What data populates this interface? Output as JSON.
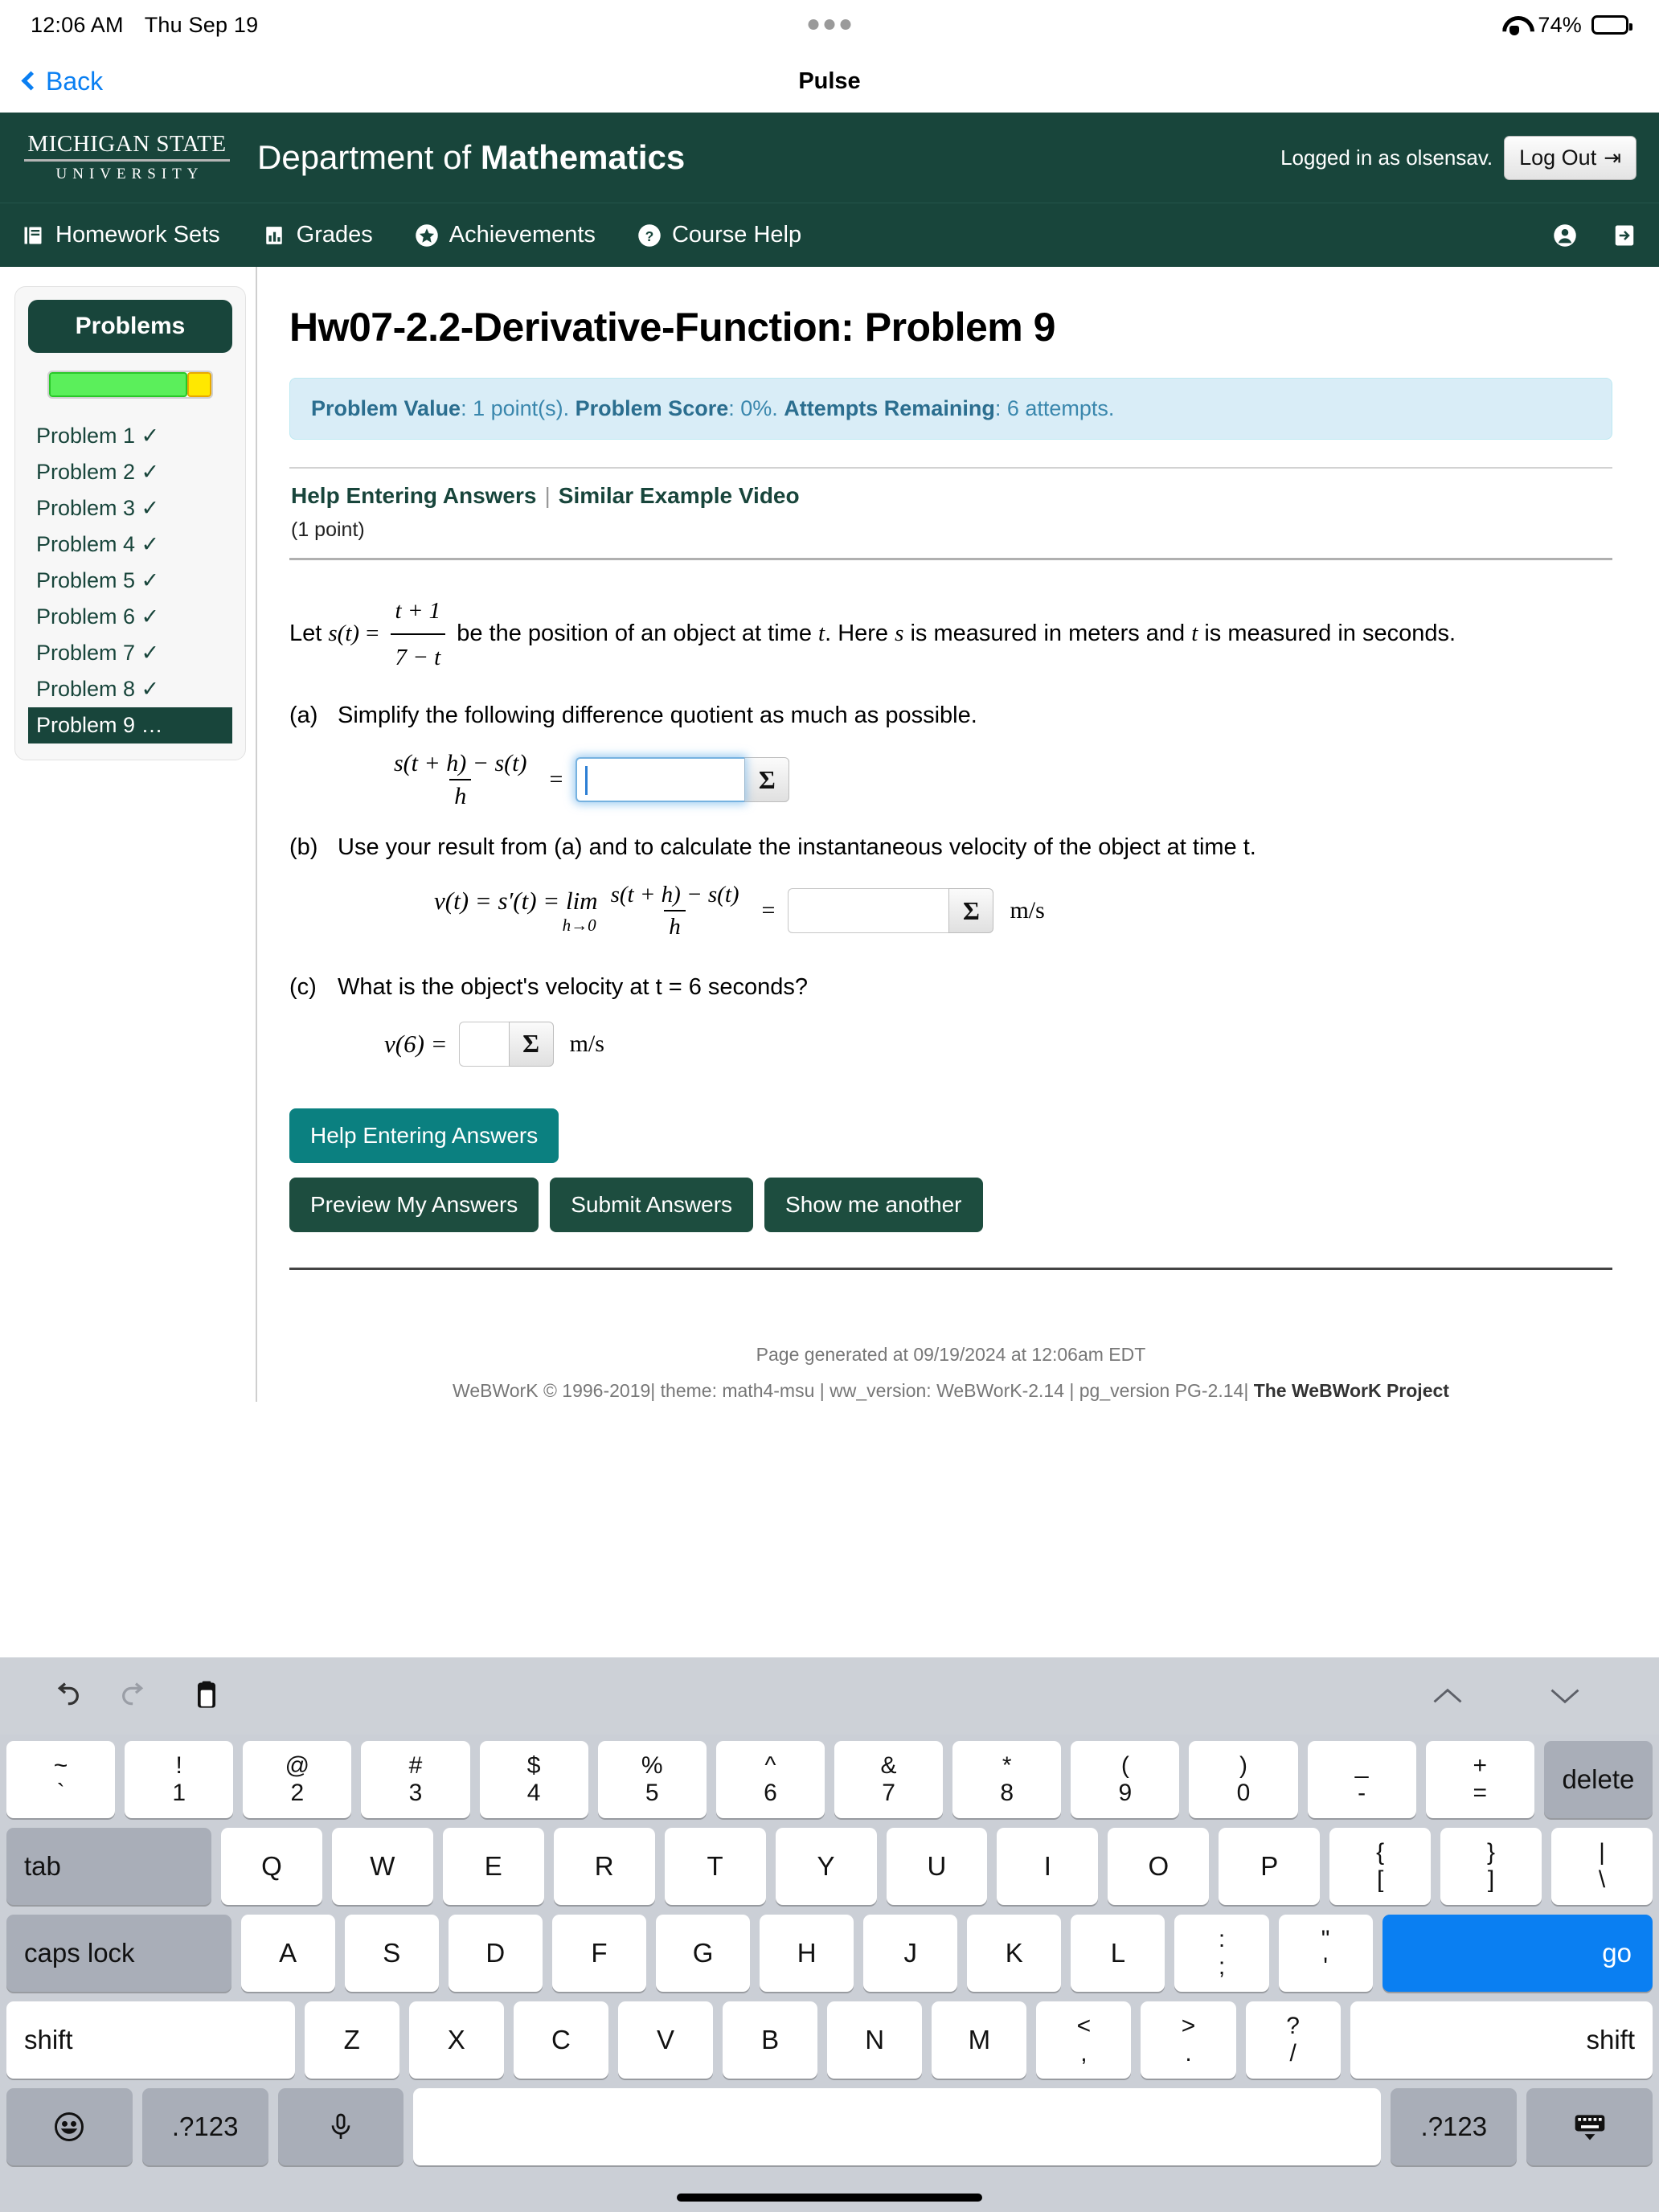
{
  "status_bar": {
    "time": "12:06 AM",
    "date": "Thu Sep 19",
    "battery_percent": "74%",
    "wifi_icon": "wifi-icon",
    "battery_icon": "battery-icon"
  },
  "browser": {
    "back_label": "Back",
    "title": "Pulse"
  },
  "site_header": {
    "logo_line1": "MICHIGAN STATE",
    "logo_line2": "UNIVERSITY",
    "department_prefix": "Department of ",
    "department_bold": "Mathematics",
    "logged_in_text": "Logged in as olsensav.",
    "logout_label": "Log Out",
    "logout_icon": "exit-icon"
  },
  "site_nav": {
    "items": [
      {
        "label": "Homework Sets",
        "icon": "book-icon"
      },
      {
        "label": "Grades",
        "icon": "bar-chart-icon"
      },
      {
        "label": "Achievements",
        "icon": "star-icon"
      },
      {
        "label": "Course Help",
        "icon": "question-circle-icon"
      }
    ],
    "right_icons": [
      {
        "name": "user-account-icon"
      },
      {
        "name": "login-arrow-icon"
      }
    ]
  },
  "sidebar": {
    "heading": "Problems",
    "progress": {
      "completed_percent": 88,
      "remaining_percent": 12
    },
    "problems": [
      {
        "label": "Problem 1 ✓",
        "active": false
      },
      {
        "label": "Problem 2 ✓",
        "active": false
      },
      {
        "label": "Problem 3 ✓",
        "active": false
      },
      {
        "label": "Problem 4 ✓",
        "active": false
      },
      {
        "label": "Problem 5 ✓",
        "active": false
      },
      {
        "label": "Problem 6 ✓",
        "active": false
      },
      {
        "label": "Problem 7 ✓",
        "active": false
      },
      {
        "label": "Problem 8 ✓",
        "active": false
      },
      {
        "label": "Problem 9 …",
        "active": true
      }
    ]
  },
  "main": {
    "page_title": "Hw07-2.2-Derivative-Function: Problem 9",
    "alert": {
      "value_label": "Problem Value",
      "value": " 1 point(s). ",
      "score_label": "Problem Score",
      "score": " 0%. ",
      "attempts_label": "Attempts Remaining",
      "attempts": " 6 attempts."
    },
    "help_links": {
      "help_entering": "Help Entering Answers",
      "separator": "|",
      "similar_video": "Similar Example Video"
    },
    "points_note": "(1 point)",
    "statement": {
      "lead": "Let ",
      "fn": "s(t)",
      "equals": "=",
      "numerator": "t + 1",
      "denominator": "7 − t",
      "tail": " be the position of an object at time ",
      "var_t": "t",
      "tail2": ". Here ",
      "var_s": "s",
      "tail3": " is measured in meters and ",
      "var_t2": "t",
      "tail4": " is measured in seconds."
    },
    "parts": [
      {
        "label": "(a)",
        "text": "Simplify the following difference quotient as much as possible.",
        "formula_num": "s(t + h) − s(t)",
        "formula_den": "h",
        "equals": "=",
        "input_value": "",
        "sigma": "Σ",
        "units": "",
        "focused": true
      },
      {
        "label": "(b)",
        "text": "Use your result from (a) and to calculate the instantaneous velocity of the object at time t.",
        "lhs": "v(t) = s′(t) = lim",
        "lim_sub": "h→0",
        "formula_num": "s(t + h) − s(t)",
        "formula_den": "h",
        "equals": "=",
        "input_value": "",
        "sigma": "Σ",
        "units": "m/s",
        "focused": false
      },
      {
        "label": "(c)",
        "text": "What is the object's velocity at t = 6 seconds?",
        "lhs": "v(6) =",
        "input_value": "",
        "sigma": "Σ",
        "units": "m/s",
        "focused": false
      }
    ],
    "buttons": {
      "help_entering": "Help Entering Answers",
      "preview": "Preview My Answers",
      "submit": "Submit Answers",
      "show_another": "Show me another"
    }
  },
  "footer": {
    "generated": "Page generated at 09/19/2024 at 12:06am EDT",
    "copyright": "WeBWorK © 1996-2019",
    "theme": "| theme: math4-msu | ww_version: WeBWorK-2.14 | pg_version PG-2.14|",
    "project": " The WeBWorK Project"
  },
  "keyboard": {
    "tools": {
      "undo": "undo-icon",
      "redo": "redo-icon",
      "paste": "paste-icon",
      "up": "chevron-up-icon",
      "down": "chevron-down-icon"
    },
    "row1": [
      {
        "top": "~",
        "bottom": "`"
      },
      {
        "top": "!",
        "bottom": "1"
      },
      {
        "top": "@",
        "bottom": "2"
      },
      {
        "top": "#",
        "bottom": "3"
      },
      {
        "top": "$",
        "bottom": "4"
      },
      {
        "top": "%",
        "bottom": "5"
      },
      {
        "top": "^",
        "bottom": "6"
      },
      {
        "top": "&",
        "bottom": "7"
      },
      {
        "top": "*",
        "bottom": "8"
      },
      {
        "top": "(",
        "bottom": "9"
      },
      {
        "top": ")",
        "bottom": "0"
      },
      {
        "top": "_",
        "bottom": "-"
      },
      {
        "top": "+",
        "bottom": "="
      }
    ],
    "delete_label": "delete",
    "tab_label": "tab",
    "row2": [
      {
        "top": "",
        "bottom": "Q"
      },
      {
        "top": "",
        "bottom": "W"
      },
      {
        "top": "",
        "bottom": "E"
      },
      {
        "top": "",
        "bottom": "R"
      },
      {
        "top": "",
        "bottom": "T"
      },
      {
        "top": "",
        "bottom": "Y"
      },
      {
        "top": "",
        "bottom": "U"
      },
      {
        "top": "",
        "bottom": "I"
      },
      {
        "top": "",
        "bottom": "O"
      },
      {
        "top": "",
        "bottom": "P"
      },
      {
        "top": "{",
        "bottom": "["
      },
      {
        "top": "}",
        "bottom": "]"
      },
      {
        "top": "|",
        "bottom": "\\"
      }
    ],
    "caps_label": "caps lock",
    "row3": [
      {
        "top": "",
        "bottom": "A"
      },
      {
        "top": "",
        "bottom": "S"
      },
      {
        "top": "",
        "bottom": "D"
      },
      {
        "top": "",
        "bottom": "F"
      },
      {
        "top": "",
        "bottom": "G"
      },
      {
        "top": "",
        "bottom": "H"
      },
      {
        "top": "",
        "bottom": "J"
      },
      {
        "top": "",
        "bottom": "K"
      },
      {
        "top": "",
        "bottom": "L"
      },
      {
        "top": ":",
        "bottom": ";"
      },
      {
        "top": "\"",
        "bottom": "'"
      }
    ],
    "go_label": "go",
    "shift_label": "shift",
    "row4": [
      {
        "top": "",
        "bottom": "Z"
      },
      {
        "top": "",
        "bottom": "X"
      },
      {
        "top": "",
        "bottom": "C"
      },
      {
        "top": "",
        "bottom": "V"
      },
      {
        "top": "",
        "bottom": "B"
      },
      {
        "top": "",
        "bottom": "N"
      },
      {
        "top": "",
        "bottom": "M"
      },
      {
        "top": "<",
        "bottom": ","
      },
      {
        "top": ">",
        "bottom": "."
      },
      {
        "top": "?",
        "bottom": "/"
      }
    ],
    "bottom": {
      "emoji": "emoji-icon",
      "numbers_left": ".?123",
      "mic": "microphone-icon",
      "space": "",
      "numbers_right": ".?123",
      "hide_keyboard": "hide-keyboard-icon"
    }
  }
}
